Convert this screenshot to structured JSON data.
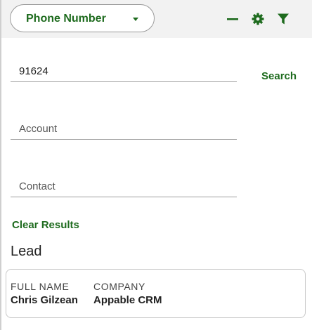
{
  "header": {
    "search_field_select": {
      "value": "Phone Number"
    },
    "icons": [
      "minimize-icon",
      "gear-icon",
      "filter-icon"
    ]
  },
  "form": {
    "phone": {
      "value": "91624"
    },
    "account": {
      "placeholder": "Account"
    },
    "contact": {
      "placeholder": "Contact"
    },
    "search_label": "Search",
    "clear_label": "Clear Results"
  },
  "results": {
    "section_title": "Lead",
    "columns": [
      "FULL NAME",
      "COMPANY"
    ],
    "rows": [
      [
        "Chris Gilzean",
        "Appable CRM"
      ]
    ]
  },
  "colors": {
    "accent": "#1e6b1e",
    "header_bg": "#f2f2f2",
    "border": "#c8c8c8"
  }
}
